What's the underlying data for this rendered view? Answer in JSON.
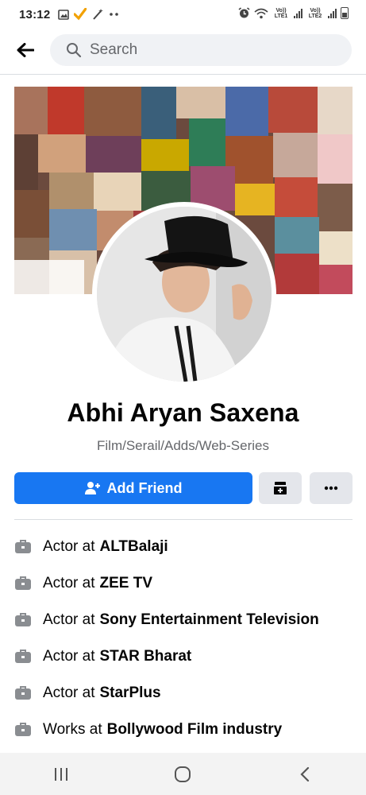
{
  "status_bar": {
    "time": "13:12",
    "left_icons": [
      "image-icon",
      "check-icon",
      "magic-wand-icon",
      "more-dots-icon"
    ],
    "right_icons": [
      "alarm-icon",
      "wifi-icon",
      "signal-sim1-icon",
      "signal-sim2-icon",
      "battery-icon"
    ],
    "sim1_label": "Vo)) LTE1",
    "sim2_label": "Vo)) LTE2"
  },
  "search": {
    "placeholder": "Search"
  },
  "profile": {
    "name": "Abhi Aryan Saxena",
    "category": "Film/Serail/Adds/Web-Series"
  },
  "actions": {
    "add_friend_label": "Add Friend",
    "add_friend_icon": "person-plus-icon",
    "secondary_icon": "save-add-icon",
    "more_icon": "more-horizontal-icon"
  },
  "work": [
    {
      "prefix": "Actor at",
      "place": "ALTBalaji"
    },
    {
      "prefix": "Actor at",
      "place": "ZEE TV"
    },
    {
      "prefix": "Actor at",
      "place": "Sony Entertainment Television"
    },
    {
      "prefix": "Actor at",
      "place": "STAR Bharat"
    },
    {
      "prefix": "Actor at",
      "place": "StarPlus"
    },
    {
      "prefix": "Works at",
      "place": "Bollywood Film industry"
    }
  ],
  "navbar": {
    "items": [
      "recents-icon",
      "home-icon",
      "back-chevron-icon"
    ]
  },
  "colors": {
    "accent": "#1877f2",
    "secondary_button": "#e4e6eb",
    "search_bg": "#f0f2f5",
    "muted_text": "#65676b",
    "navbar_bg": "#f3f3f3"
  }
}
